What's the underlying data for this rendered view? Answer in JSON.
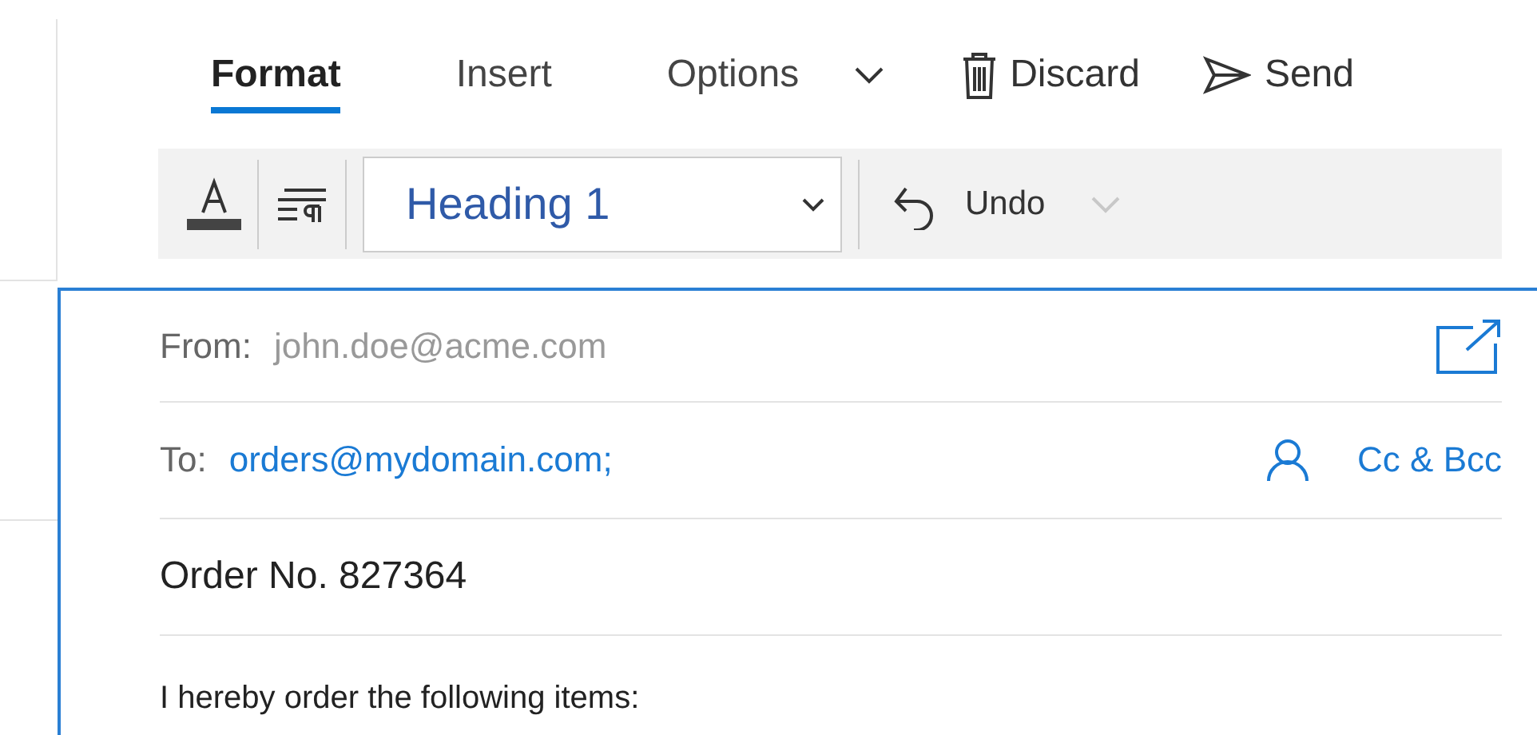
{
  "tabs": [
    {
      "label": "Format",
      "selected": true
    },
    {
      "label": "Insert",
      "selected": false
    },
    {
      "label": "Options",
      "selected": false
    }
  ],
  "actions": [
    {
      "kind": "discard",
      "label": "Discard"
    },
    {
      "kind": "send",
      "label": "Send"
    }
  ],
  "toolbar": {
    "style_value": "Heading 1",
    "undo_label": "Undo",
    "undo_menu_disabled": true
  },
  "message": {
    "from_label": "From:",
    "from_value": "john.doe@acme.com",
    "to_label": "To:",
    "to_value": "orders@mydomain.com;",
    "cc_bcc": "Cc & Bcc",
    "subject": "Order No. 827364",
    "body": "I hereby order the following items:"
  }
}
